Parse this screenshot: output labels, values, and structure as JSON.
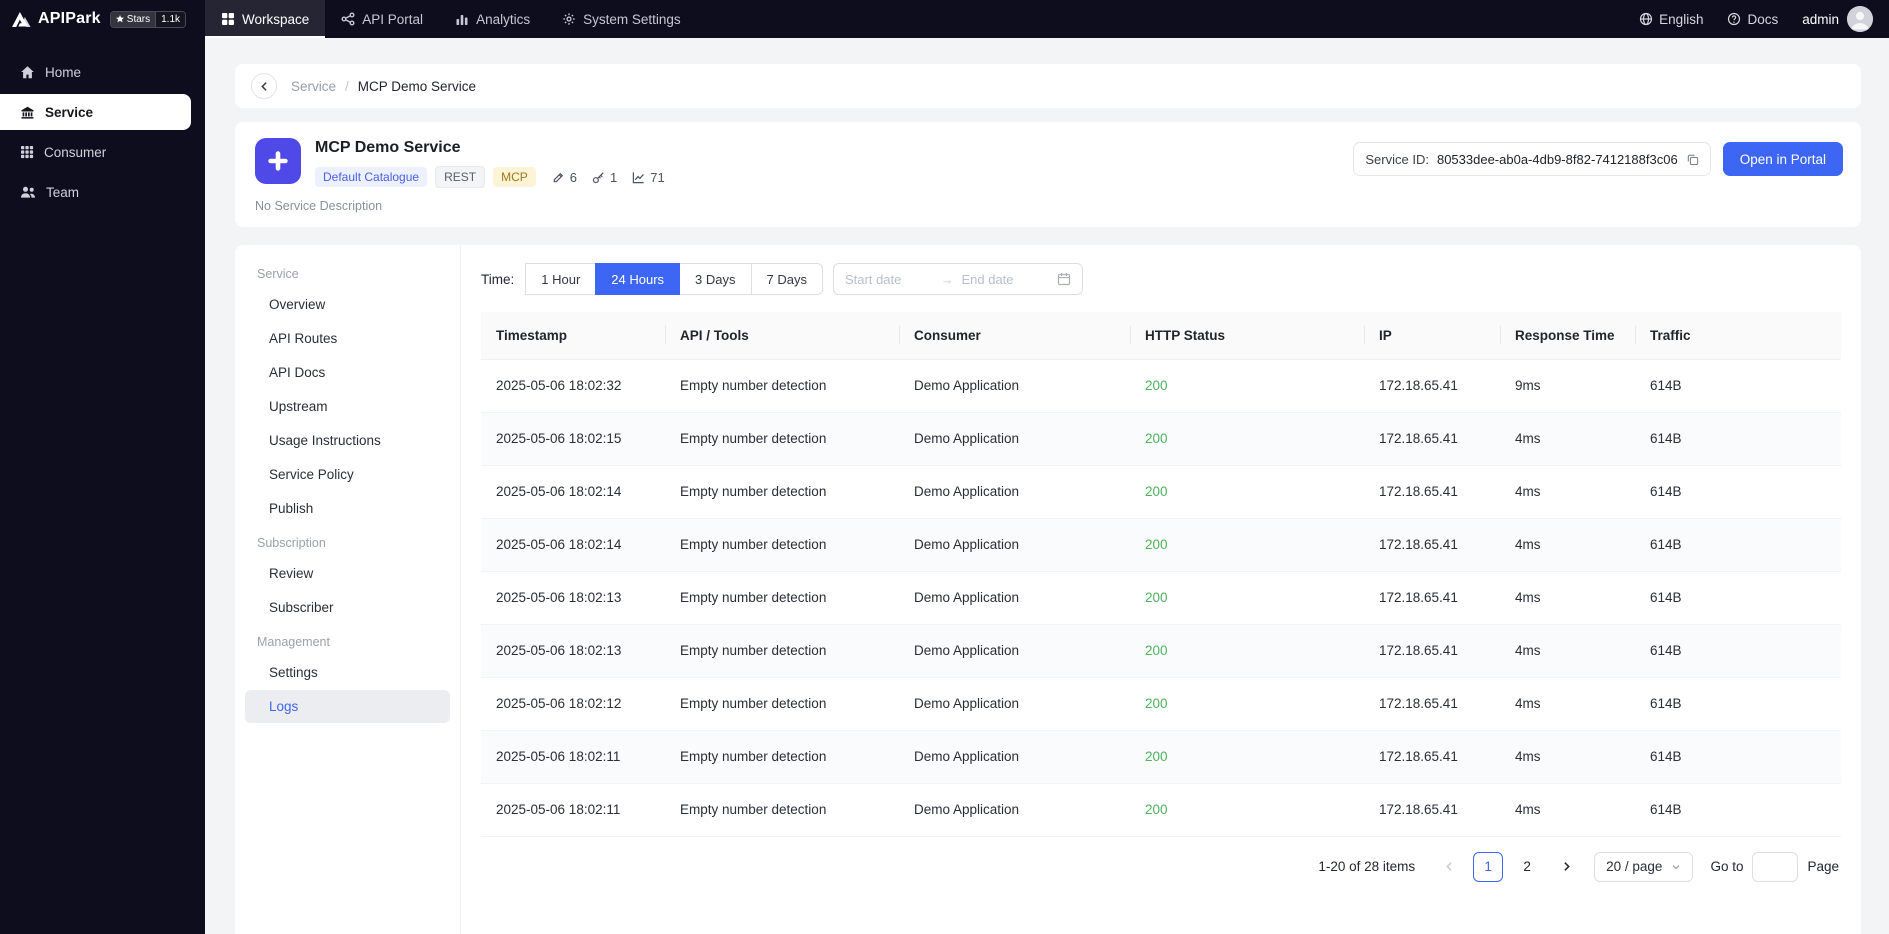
{
  "colors": {
    "primary": "#3d66f5",
    "status_ok": "#4db35e",
    "service_icon_bg": "#4f49e8",
    "dark_bg": "#0d0d1d"
  },
  "topnav": {
    "brand": "APIPark",
    "stars": {
      "label": "Stars",
      "count": "1.1k"
    },
    "tabs": [
      {
        "label": "Workspace",
        "active": true
      },
      {
        "label": "API Portal"
      },
      {
        "label": "Analytics"
      },
      {
        "label": "System Settings"
      }
    ],
    "language": "English",
    "docs": "Docs",
    "user": "admin"
  },
  "sidebar": {
    "items": [
      {
        "label": "Home"
      },
      {
        "label": "Service",
        "active": true
      },
      {
        "label": "Consumer"
      },
      {
        "label": "Team"
      }
    ]
  },
  "breadcrumb": {
    "parent": "Service",
    "separator": "/",
    "current": "MCP Demo Service"
  },
  "service": {
    "title": "MCP Demo Service",
    "tags": {
      "catalogue": "Default Catalogue",
      "rest": "REST",
      "mcp": "MCP"
    },
    "stats": {
      "apis": "6",
      "subscribers": "1",
      "calls": "71"
    },
    "description": "No Service Description",
    "id_label": "Service ID:",
    "id_value": "80533dee-ab0a-4db9-8f82-7412188f3c06",
    "portal_button": "Open in Portal"
  },
  "inner_nav": {
    "sections": [
      {
        "label": "Service",
        "items": [
          {
            "label": "Overview"
          },
          {
            "label": "API Routes"
          },
          {
            "label": "API Docs"
          },
          {
            "label": "Upstream"
          },
          {
            "label": "Usage Instructions"
          },
          {
            "label": "Service Policy"
          },
          {
            "label": "Publish"
          }
        ]
      },
      {
        "label": "Subscription",
        "items": [
          {
            "label": "Review"
          },
          {
            "label": "Subscriber"
          }
        ]
      },
      {
        "label": "Management",
        "items": [
          {
            "label": "Settings"
          },
          {
            "label": "Logs",
            "active": true
          }
        ]
      }
    ]
  },
  "filters": {
    "label": "Time:",
    "options": [
      {
        "label": "1 Hour"
      },
      {
        "label": "24 Hours",
        "active": true
      },
      {
        "label": "3 Days"
      },
      {
        "label": "7 Days"
      }
    ],
    "start_placeholder": "Start date",
    "end_placeholder": "End date",
    "range_arrow": "→"
  },
  "table": {
    "columns": [
      "Timestamp",
      "API / Tools",
      "Consumer",
      "HTTP Status",
      "IP",
      "Response Time",
      "Traffic"
    ],
    "rows": [
      [
        "2025-05-06 18:02:32",
        "Empty number detection",
        "Demo Application",
        "200",
        "172.18.65.41",
        "9ms",
        "614B"
      ],
      [
        "2025-05-06 18:02:15",
        "Empty number detection",
        "Demo Application",
        "200",
        "172.18.65.41",
        "4ms",
        "614B"
      ],
      [
        "2025-05-06 18:02:14",
        "Empty number detection",
        "Demo Application",
        "200",
        "172.18.65.41",
        "4ms",
        "614B"
      ],
      [
        "2025-05-06 18:02:14",
        "Empty number detection",
        "Demo Application",
        "200",
        "172.18.65.41",
        "4ms",
        "614B"
      ],
      [
        "2025-05-06 18:02:13",
        "Empty number detection",
        "Demo Application",
        "200",
        "172.18.65.41",
        "4ms",
        "614B"
      ],
      [
        "2025-05-06 18:02:13",
        "Empty number detection",
        "Demo Application",
        "200",
        "172.18.65.41",
        "4ms",
        "614B"
      ],
      [
        "2025-05-06 18:02:12",
        "Empty number detection",
        "Demo Application",
        "200",
        "172.18.65.41",
        "4ms",
        "614B"
      ],
      [
        "2025-05-06 18:02:11",
        "Empty number detection",
        "Demo Application",
        "200",
        "172.18.65.41",
        "4ms",
        "614B"
      ],
      [
        "2025-05-06 18:02:11",
        "Empty number detection",
        "Demo Application",
        "200",
        "172.18.65.41",
        "4ms",
        "614B"
      ]
    ]
  },
  "pagination": {
    "total": "1-20 of 28 items",
    "pages": [
      {
        "label": "1",
        "active": true
      },
      {
        "label": "2"
      }
    ],
    "page_size": "20 / page",
    "goto_label": "Go to",
    "page_label": "Page"
  }
}
